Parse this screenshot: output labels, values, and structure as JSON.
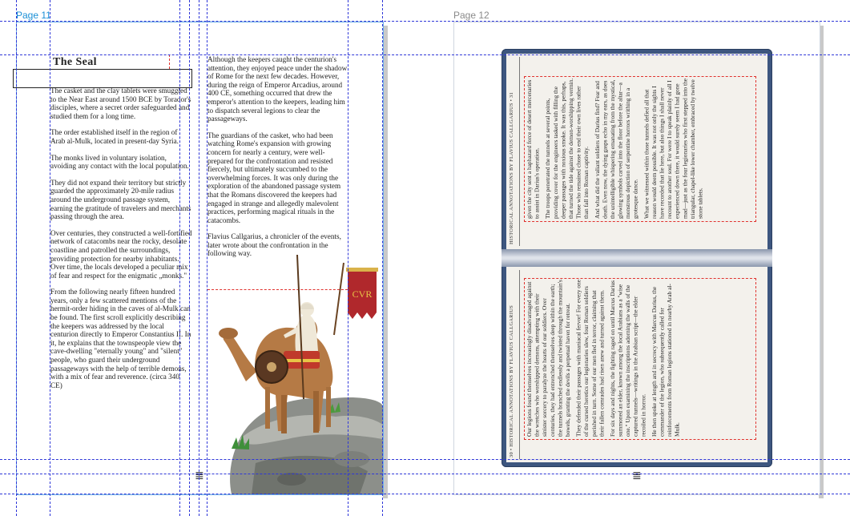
{
  "pages": {
    "left_label": "Page 11",
    "right_label": "Page 12"
  },
  "left_page": {
    "heading": "The Seal",
    "col1": [
      "The casket and the clay tablets were smuggled to the Near East around 1500 BCE by Torador's disciples, where a secret order safeguarded and studied them for a long time.",
      "The order established itself in the region of Arab al-Mulk, located in present-day Syria.",
      "The monks lived in voluntary isolation, avoiding any contact with the local population.",
      "They did not expand their territory but strictly guarded the approximately 20-mile radius around the underground passage system, earning the gratitude of travelers and merchants passing through the area.",
      "Over centuries, they constructed a well-fortified network of catacombs near the rocky, desolate coastline and patrolled the surroundings, providing protection for nearby inhabitants. Over time, the locals developed a peculiar mix of fear and respect for the enigmatic „monks.\"",
      "From the following nearly fifteen hundred years, only a few scattered mentions of the hermit-order hiding in the caves of al-Mulk can be found. The first scroll explicitly describing the keepers was addressed by the local centurion directly to Emperor Constantius II. In it, he explains that the townspeople view the cave-dwelling \"eternally young\" and \"silent\" people, who guard their underground passageways with the help of terrible demons, with a mix of fear and reverence. (circa 340 CE)"
    ],
    "col2": [
      "Although the keepers caught the centurion's attention, they enjoyed peace under the shadow of Rome for the next few decades. However, during the reign of Emperor Arcadius, around 400 CE, something occurred that drew the emperor's attention to the keepers, leading him to dispatch several legions to clear the passageways.",
      "The guardians of the casket, who had been watching Rome's expansion with growing concern for nearly a century, were well-prepared for the confrontation and resisted fiercely, but ultimately succumbed to the overwhelming forces. It was only during the exploration of the abandoned passage system that the Romans discovered the keepers had engaged in strange and allegedly malevolent practices, performing magical rituals in the catacombs.",
      "Flavius Callgarius, a chronicler of the events, later wrote about the confrontation in the following way."
    ],
    "banner_text": "CVR"
  },
  "book": {
    "top_header": "HISTORICAL ANNOTATIONS BY FLAVIUS CALLGARIUS • 31",
    "bottom_header": "30 • HISTORICAL ANNOTATIONS BY FLAVIUS CALLGARIUS",
    "top_text": [
      "given the city sent a haphazard force of desert mercenaries to assist in Darius's operation.",
      "The troops penetrated the tunnels at several points, providing cover for the engineers tasked with filling the deeper passages with noxious smoke. It was this, perhaps, that turned the tide against the demon-worshipping vermin. Those who remained chose to end their own lives rather than fall into Roman captivity.",
      "And what did the valiant soldiers of Darius find? Fear and death. Even now, the dying gasps echo in my ears, as does the unintelligible whispering emanating from the mystical, glowing symbols carved into the floor before the altar—a monstrous depiction of serpentine horrors writhing in a grotesque dance.",
      "What we witnessed within those tunnels defied all that reason would deem possible. It was not only the sights I have recorded that lie here, but also things I shall never recount to another soul. For were I to speak plainly of all I experienced down there, it would surely seem I had gone mad—just as the four legionaries who first stepped into the triangular, chapel-like lower chamber, embraced by twelve stone tablets."
    ],
    "bottom_text": [
      "Our legions found themselves increasingly disadvantaged against the wretches who worshipped demons, attempting with their sinister sorcery to paralyze the hearts of our soldiers. Over centuries, they had entrenched themselves deep within the earth; the tunnels branched endlessly and twisted through the mountain's bowels, granting the devils a perpetual haven for retreat.",
      "They defended their passages with maniacal fervor! For every one of the cursed heretics our legionaries slew, four Roman soldiers perished in turn. Some of our men fled in terror, claiming that their fallen comrades had risen anew and turned against them.",
      "For six days and nights, the fighting raged on until Marcus Darius summoned an elder, known among the local Arabians as a \"wise one.\" Upon examining the inscriptions adorning the walls of the captured tunnels—writings in the Arabian script—the elder recoiled in horror.",
      "He then spoke at length and in secrecy with Marcus Darius, the commander of the legion, who subsequently called for reinforcements from Roman legions stationed in nearby Arab al-Mulk."
    ]
  },
  "page_indicators": {
    "left_icon": "page-number-marker-icon",
    "right_icon": "page-number-marker-icon"
  },
  "colors": {
    "guide": "#2f37d8",
    "frame": "#e0332f",
    "book_cover": "#3d567f",
    "page_label": "#1a8fd6"
  }
}
